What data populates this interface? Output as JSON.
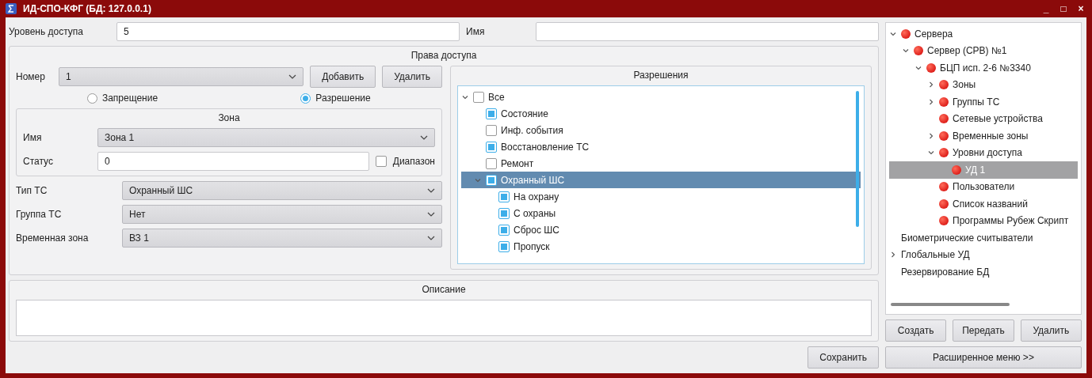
{
  "window": {
    "title": "ИД-СПО-КФГ (БД: 127.0.0.1)",
    "controls": [
      "_",
      "□",
      "×"
    ]
  },
  "access_level": {
    "label": "Уровень доступа",
    "value": "5"
  },
  "name": {
    "label": "Имя"
  },
  "rights": {
    "title": "Права доступа",
    "number": {
      "label": "Номер",
      "value": "1"
    },
    "buttons": [
      "Добавить",
      "Удалить"
    ],
    "modes": [
      {
        "label": "Запрещение",
        "selected": false
      },
      {
        "label": "Разрешение",
        "selected": true
      }
    ],
    "zone": {
      "title": "Зона",
      "name_label": "Имя",
      "name_value": "Зона 1",
      "status_label": "Статус",
      "status_value": "0",
      "range": {
        "label": "Диапазон",
        "checked": false
      }
    },
    "fields": [
      {
        "label": "Тип ТС",
        "value": "Охранный ШС"
      },
      {
        "label": "Группа ТС",
        "value": "Нет"
      },
      {
        "label": "Временная зона",
        "value": "ВЗ 1"
      }
    ],
    "permissions": {
      "title": "Разрешения",
      "items": [
        {
          "label": "Все",
          "checked": false,
          "selected": false,
          "expanded": true,
          "children": [
            {
              "label": "Состояние",
              "checked": true,
              "selected": false
            },
            {
              "label": "Инф. события",
              "checked": false,
              "selected": false
            },
            {
              "label": "Восстановление ТС",
              "checked": true,
              "selected": false
            },
            {
              "label": "Ремонт",
              "checked": false,
              "selected": false
            },
            {
              "label": "Охранный ШС",
              "checked": true,
              "selected": true,
              "expanded": true,
              "children": [
                {
                  "label": "На охрану",
                  "checked": true,
                  "selected": false
                },
                {
                  "label": "С охраны",
                  "checked": true,
                  "selected": false
                },
                {
                  "label": "Сброс ШС",
                  "checked": true,
                  "selected": false
                },
                {
                  "label": "Пропуск",
                  "checked": true,
                  "selected": false
                }
              ]
            }
          ]
        }
      ]
    }
  },
  "description": {
    "title": "Описание"
  },
  "save_button": "Сохранить",
  "tree": [
    {
      "label": "Сервера",
      "kind": "device",
      "selected": false,
      "expanded": true,
      "children": [
        {
          "label": "Сервер (СРВ) №1",
          "kind": "device",
          "selected": false,
          "expanded": true,
          "children": [
            {
              "label": "БЦП исп. 2-6 №3340",
              "kind": "device",
              "selected": false,
              "expanded": true,
              "children": [
                {
                  "label": "Зоны",
                  "kind": "device",
                  "selected": false,
                  "expanded": false
                },
                {
                  "label": "Группы ТС",
                  "kind": "device",
                  "selected": false,
                  "expanded": false
                },
                {
                  "label": "Сетевые устройства",
                  "kind": "device",
                  "selected": false
                },
                {
                  "label": "Временные зоны",
                  "kind": "device",
                  "selected": false,
                  "expanded": false
                },
                {
                  "label": "Уровни доступа",
                  "kind": "device",
                  "selected": false,
                  "expanded": true,
                  "children": [
                    {
                      "label": "УД 1",
                      "kind": "device",
                      "selected": true
                    }
                  ]
                },
                {
                  "label": "Пользователи",
                  "kind": "device",
                  "selected": false
                },
                {
                  "label": "Список названий",
                  "kind": "device",
                  "selected": false
                },
                {
                  "label": "Программы Рубеж Скрипт",
                  "kind": "device",
                  "selected": false
                }
              ]
            }
          ]
        }
      ]
    },
    {
      "label": "Биометрические считыватели",
      "kind": "folder",
      "selected": false
    },
    {
      "label": "Глобальные УД",
      "kind": "folder",
      "selected": false,
      "expanded": false
    },
    {
      "label": "Резервирование БД",
      "kind": "folder",
      "selected": false
    }
  ],
  "tree_buttons": [
    "Создать",
    "Передать",
    "Удалить"
  ],
  "menu_button": "Расширенное меню >>"
}
